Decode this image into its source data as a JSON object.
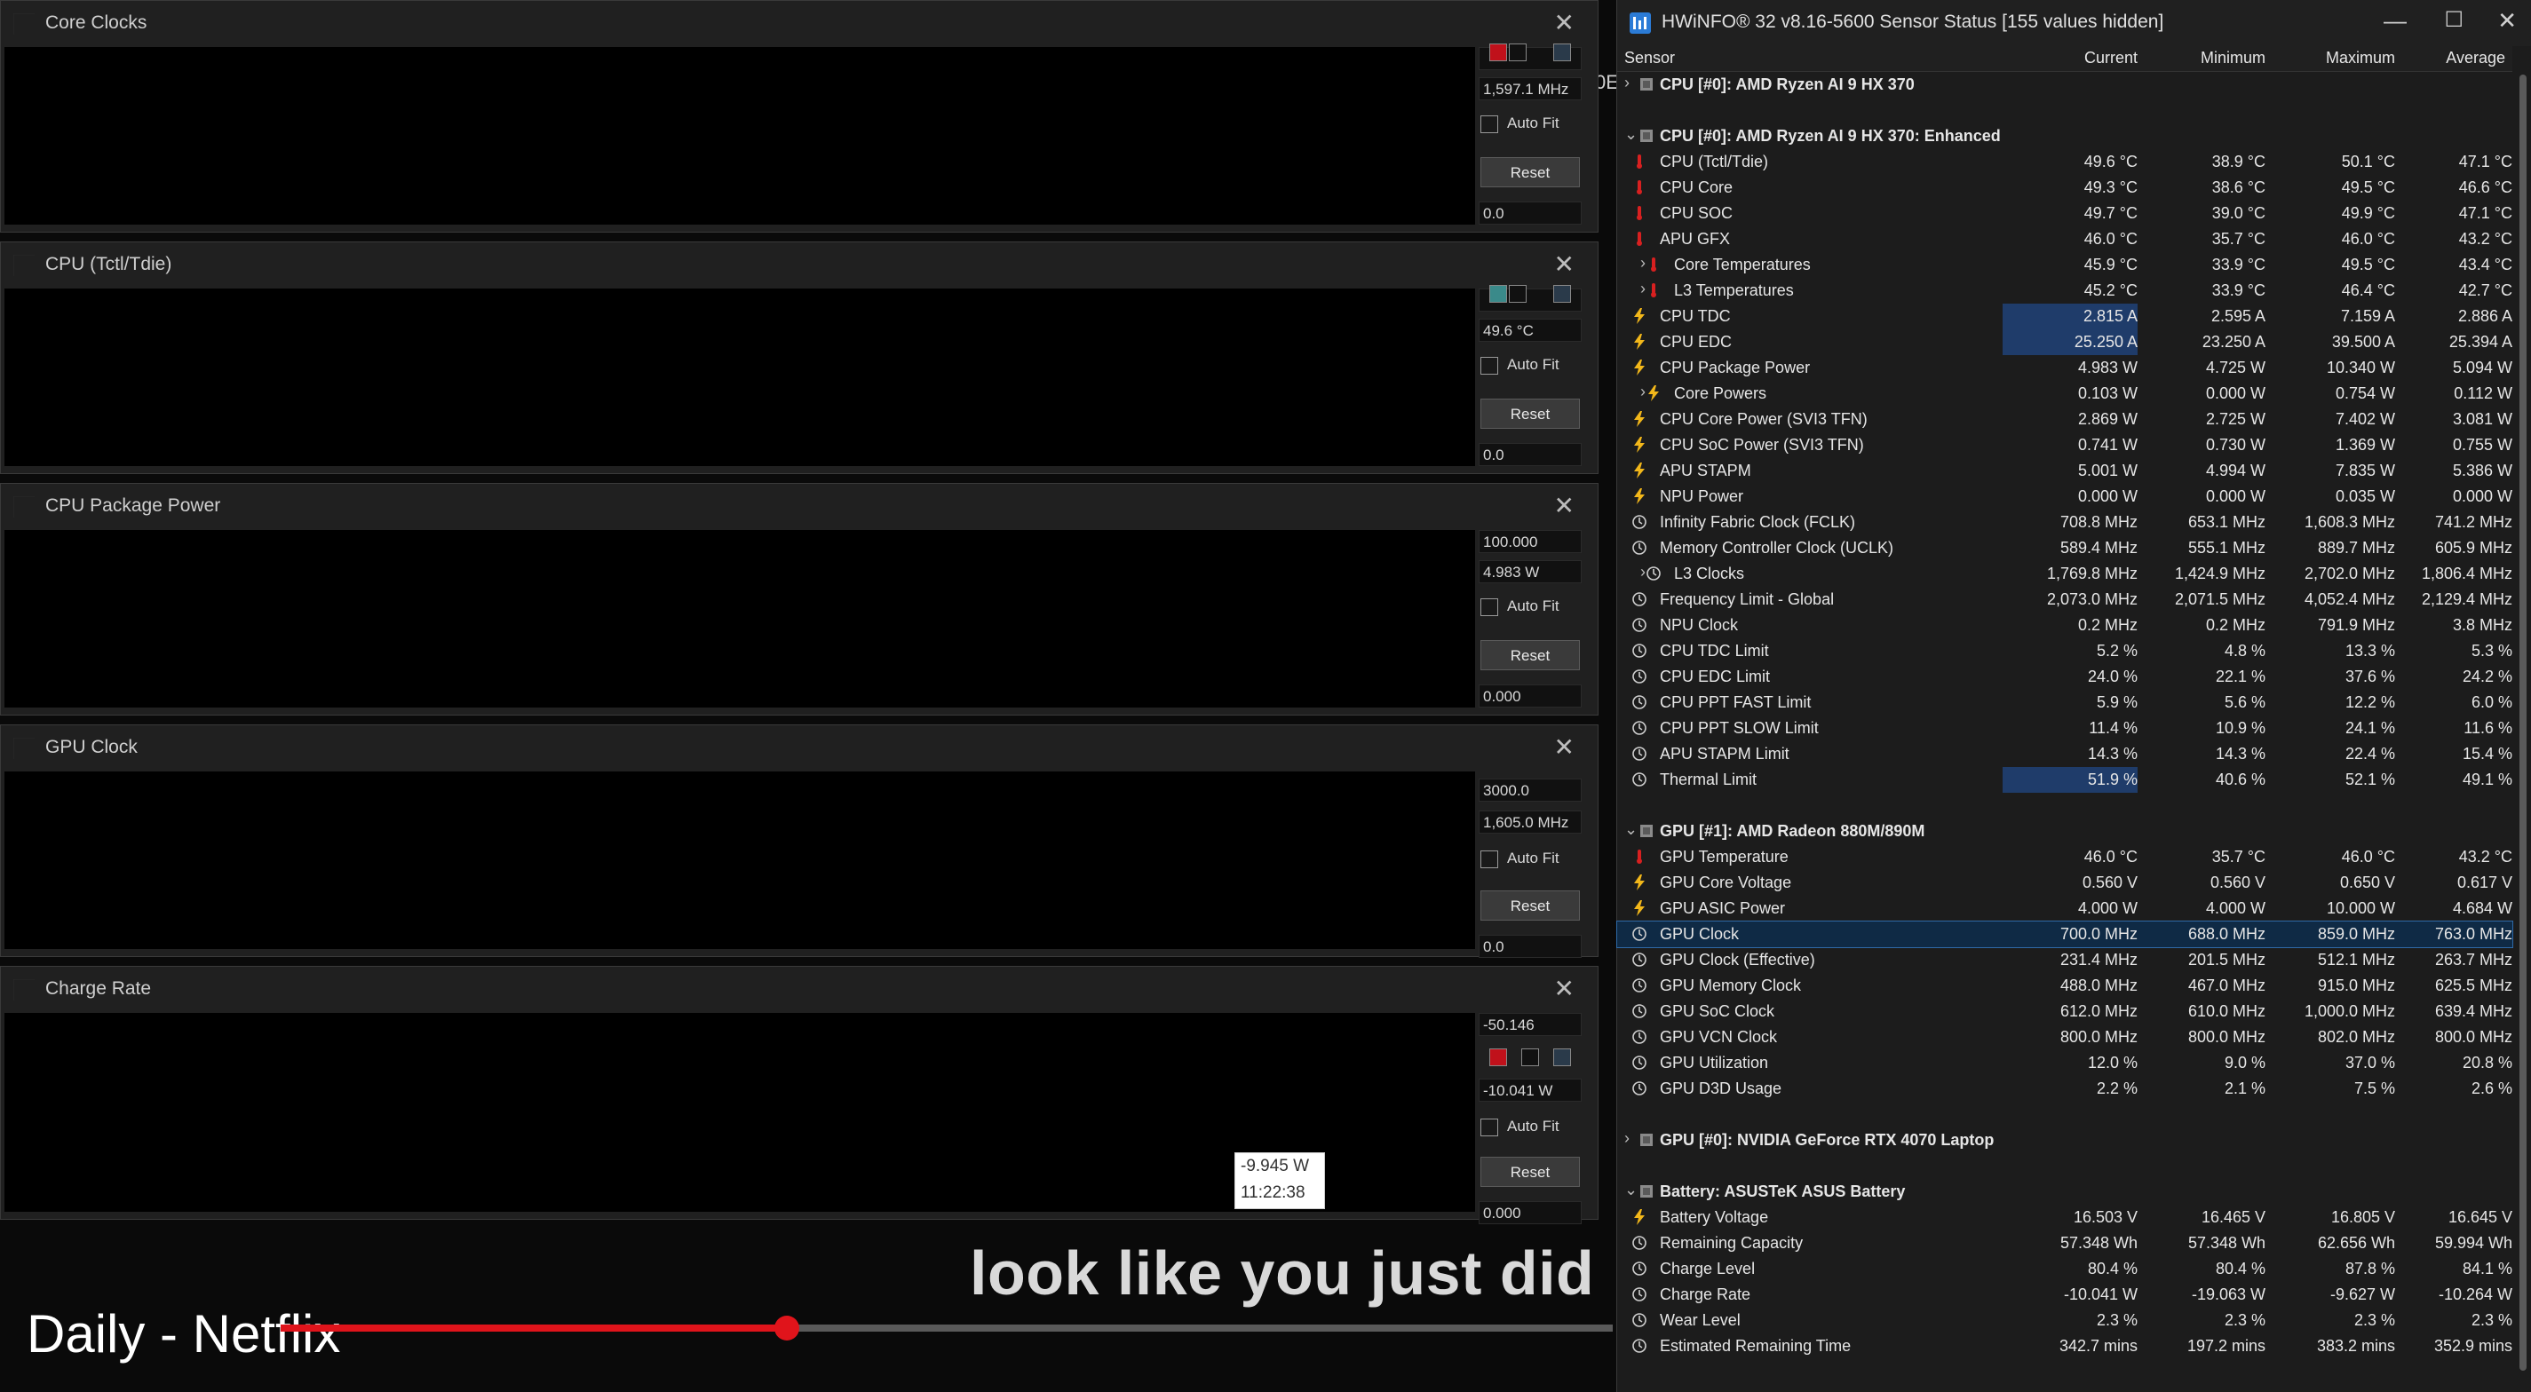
{
  "graphs": [
    {
      "title": "Core Clocks",
      "values": {
        "top": "",
        "current": "1,597.1 MHz",
        "bottom": "0.0"
      },
      "autofit": "Auto Fit",
      "reset": "Reset",
      "color": "#c0111b"
    },
    {
      "title": "CPU (Tctl/Tdie)",
      "values": {
        "top": "",
        "current": "49.6 °C",
        "bottom": "0.0"
      },
      "autofit": "Auto Fit",
      "reset": "Reset",
      "color": "#3a8a8a"
    },
    {
      "title": "CPU Package Power",
      "values": {
        "top": "100.000",
        "current": "4.983 W",
        "bottom": "0.000"
      },
      "autofit": "Auto Fit",
      "reset": "Reset",
      "color": "#2a6fcf"
    },
    {
      "title": "GPU Clock",
      "values": {
        "top": "3000.0",
        "current": "1,605.0 MHz",
        "bottom": "0.0"
      },
      "autofit": "Auto Fit",
      "reset": "Reset",
      "color": "#c0111b"
    },
    {
      "title": "Charge Rate",
      "values": {
        "top": "-50.146",
        "current": "-10.041 W",
        "bottom": "0.000"
      },
      "autofit": "Auto Fit",
      "reset": "Reset",
      "color": "#c0111b"
    }
  ],
  "tooltip": {
    "value": "-9.945 W",
    "time": "11:22:38"
  },
  "background_text": "0E",
  "video": {
    "caption": "look like you just did",
    "title": "Daily - Netflix",
    "progress": 0.38
  },
  "hwinfo": {
    "title": "HWiNFO® 32 v8.16-5600 Sensor Status [155 values hidden]",
    "columns": [
      "Sensor",
      "Current",
      "Minimum",
      "Maximum",
      "Average"
    ],
    "rows": [
      {
        "t": "group",
        "exp": "›",
        "name": "CPU [#0]: AMD Ryzen AI 9 HX 370",
        "ico": "chip-icon"
      },
      {
        "t": "blank"
      },
      {
        "t": "group",
        "exp": "⌄",
        "name": "CPU [#0]: AMD Ryzen AI 9 HX 370: Enhanced",
        "ico": "chip-icon"
      },
      {
        "t": "s",
        "ico": "thermometer-icon",
        "name": "CPU (Tctl/Tdie)",
        "v": [
          "49.6 °C",
          "38.9 °C",
          "50.1 °C",
          "47.1 °C"
        ]
      },
      {
        "t": "s",
        "ico": "thermometer-icon",
        "name": "CPU Core",
        "v": [
          "49.3 °C",
          "38.6 °C",
          "49.5 °C",
          "46.6 °C"
        ]
      },
      {
        "t": "s",
        "ico": "thermometer-icon",
        "name": "CPU SOC",
        "v": [
          "49.7 °C",
          "39.0 °C",
          "49.9 °C",
          "47.1 °C"
        ]
      },
      {
        "t": "s",
        "ico": "thermometer-icon",
        "name": "APU GFX",
        "v": [
          "46.0 °C",
          "35.7 °C",
          "46.0 °C",
          "43.2 °C"
        ]
      },
      {
        "t": "s",
        "ico": "thermometer-icon",
        "name": "Core Temperatures",
        "sub": true,
        "exp": "›",
        "v": [
          "45.9 °C",
          "33.9 °C",
          "49.5 °C",
          "43.4 °C"
        ]
      },
      {
        "t": "s",
        "ico": "thermometer-icon",
        "name": "L3 Temperatures",
        "sub": true,
        "exp": "›",
        "v": [
          "45.2 °C",
          "33.9 °C",
          "46.4 °C",
          "42.7 °C"
        ]
      },
      {
        "t": "s",
        "ico": "bolt-icon",
        "name": "CPU TDC",
        "hl": true,
        "v": [
          "2.815 A",
          "2.595 A",
          "7.159 A",
          "2.886 A"
        ]
      },
      {
        "t": "s",
        "ico": "bolt-icon",
        "name": "CPU EDC",
        "hl": true,
        "v": [
          "25.250 A",
          "23.250 A",
          "39.500 A",
          "25.394 A"
        ]
      },
      {
        "t": "s",
        "ico": "bolt-icon",
        "name": "CPU Package Power",
        "v": [
          "4.983 W",
          "4.725 W",
          "10.340 W",
          "5.094 W"
        ]
      },
      {
        "t": "s",
        "ico": "bolt-icon",
        "name": "Core Powers",
        "sub": true,
        "exp": "›",
        "v": [
          "0.103 W",
          "0.000 W",
          "0.754 W",
          "0.112 W"
        ]
      },
      {
        "t": "s",
        "ico": "bolt-icon",
        "name": "CPU Core Power (SVI3 TFN)",
        "v": [
          "2.869 W",
          "2.725 W",
          "7.402 W",
          "3.081 W"
        ]
      },
      {
        "t": "s",
        "ico": "bolt-icon",
        "name": "CPU SoC Power (SVI3 TFN)",
        "v": [
          "0.741 W",
          "0.730 W",
          "1.369 W",
          "0.755 W"
        ]
      },
      {
        "t": "s",
        "ico": "bolt-icon",
        "name": "APU STAPM",
        "v": [
          "5.001 W",
          "4.994 W",
          "7.835 W",
          "5.386 W"
        ]
      },
      {
        "t": "s",
        "ico": "bolt-icon",
        "name": "NPU Power",
        "v": [
          "0.000 W",
          "0.000 W",
          "0.035 W",
          "0.000 W"
        ]
      },
      {
        "t": "s",
        "ico": "clock-icon",
        "name": "Infinity Fabric Clock (FCLK)",
        "v": [
          "708.8 MHz",
          "653.1 MHz",
          "1,608.3 MHz",
          "741.2 MHz"
        ]
      },
      {
        "t": "s",
        "ico": "clock-icon",
        "name": "Memory Controller Clock (UCLK)",
        "v": [
          "589.4 MHz",
          "555.1 MHz",
          "889.7 MHz",
          "605.9 MHz"
        ]
      },
      {
        "t": "s",
        "ico": "clock-icon",
        "name": "L3 Clocks",
        "sub": true,
        "exp": "›",
        "v": [
          "1,769.8 MHz",
          "1,424.9 MHz",
          "2,702.0 MHz",
          "1,806.4 MHz"
        ]
      },
      {
        "t": "s",
        "ico": "clock-icon",
        "name": "Frequency Limit - Global",
        "v": [
          "2,073.0 MHz",
          "2,071.5 MHz",
          "4,052.4 MHz",
          "2,129.4 MHz"
        ]
      },
      {
        "t": "s",
        "ico": "clock-icon",
        "name": "NPU Clock",
        "v": [
          "0.2 MHz",
          "0.2 MHz",
          "791.9 MHz",
          "3.8 MHz"
        ]
      },
      {
        "t": "s",
        "ico": "clock-icon",
        "name": "CPU TDC Limit",
        "v": [
          "5.2 %",
          "4.8 %",
          "13.3 %",
          "5.3 %"
        ]
      },
      {
        "t": "s",
        "ico": "clock-icon",
        "name": "CPU EDC Limit",
        "v": [
          "24.0 %",
          "22.1 %",
          "37.6 %",
          "24.2 %"
        ]
      },
      {
        "t": "s",
        "ico": "clock-icon",
        "name": "CPU PPT FAST Limit",
        "v": [
          "5.9 %",
          "5.6 %",
          "12.2 %",
          "6.0 %"
        ]
      },
      {
        "t": "s",
        "ico": "clock-icon",
        "name": "CPU PPT SLOW Limit",
        "v": [
          "11.4 %",
          "10.9 %",
          "24.1 %",
          "11.6 %"
        ]
      },
      {
        "t": "s",
        "ico": "clock-icon",
        "name": "APU STAPM Limit",
        "v": [
          "14.3 %",
          "14.3 %",
          "22.4 %",
          "15.4 %"
        ]
      },
      {
        "t": "s",
        "ico": "clock-icon",
        "name": "Thermal Limit",
        "hl": true,
        "v": [
          "51.9 %",
          "40.6 %",
          "52.1 %",
          "49.1 %"
        ]
      },
      {
        "t": "blank"
      },
      {
        "t": "group",
        "exp": "⌄",
        "name": "GPU [#1]: AMD Radeon 880M/890M",
        "ico": "chip-icon"
      },
      {
        "t": "s",
        "ico": "thermometer-icon",
        "name": "GPU Temperature",
        "v": [
          "46.0 °C",
          "35.7 °C",
          "46.0 °C",
          "43.2 °C"
        ]
      },
      {
        "t": "s",
        "ico": "bolt-icon",
        "name": "GPU Core Voltage",
        "v": [
          "0.560 V",
          "0.560 V",
          "0.650 V",
          "0.617 V"
        ]
      },
      {
        "t": "s",
        "ico": "bolt-icon",
        "name": "GPU ASIC Power",
        "v": [
          "4.000 W",
          "4.000 W",
          "10.000 W",
          "4.684 W"
        ]
      },
      {
        "t": "s",
        "ico": "clock-icon",
        "name": "GPU Clock",
        "sel": true,
        "v": [
          "700.0 MHz",
          "688.0 MHz",
          "859.0 MHz",
          "763.0 MHz"
        ]
      },
      {
        "t": "s",
        "ico": "clock-icon",
        "name": "GPU Clock (Effective)",
        "v": [
          "231.4 MHz",
          "201.5 MHz",
          "512.1 MHz",
          "263.7 MHz"
        ]
      },
      {
        "t": "s",
        "ico": "clock-icon",
        "name": "GPU Memory Clock",
        "v": [
          "488.0 MHz",
          "467.0 MHz",
          "915.0 MHz",
          "625.5 MHz"
        ]
      },
      {
        "t": "s",
        "ico": "clock-icon",
        "name": "GPU SoC Clock",
        "v": [
          "612.0 MHz",
          "610.0 MHz",
          "1,000.0 MHz",
          "639.4 MHz"
        ]
      },
      {
        "t": "s",
        "ico": "clock-icon",
        "name": "GPU VCN Clock",
        "v": [
          "800.0 MHz",
          "800.0 MHz",
          "802.0 MHz",
          "800.0 MHz"
        ]
      },
      {
        "t": "s",
        "ico": "clock-icon",
        "name": "GPU Utilization",
        "v": [
          "12.0 %",
          "9.0 %",
          "37.0 %",
          "20.8 %"
        ]
      },
      {
        "t": "s",
        "ico": "clock-icon",
        "name": "GPU D3D Usage",
        "v": [
          "2.2 %",
          "2.1 %",
          "7.5 %",
          "2.6 %"
        ]
      },
      {
        "t": "blank"
      },
      {
        "t": "group",
        "exp": "›",
        "name": "GPU [#0]: NVIDIA GeForce RTX 4070 Laptop",
        "ico": "chip-icon"
      },
      {
        "t": "blank"
      },
      {
        "t": "group",
        "exp": "⌄",
        "name": "Battery: ASUSTeK ASUS Battery",
        "ico": "chip-icon"
      },
      {
        "t": "s",
        "ico": "bolt-icon",
        "name": "Battery Voltage",
        "v": [
          "16.503 V",
          "16.465 V",
          "16.805 V",
          "16.645 V"
        ]
      },
      {
        "t": "s",
        "ico": "clock-icon",
        "name": "Remaining Capacity",
        "v": [
          "57.348 Wh",
          "57.348 Wh",
          "62.656 Wh",
          "59.994 Wh"
        ]
      },
      {
        "t": "s",
        "ico": "clock-icon",
        "name": "Charge Level",
        "v": [
          "80.4 %",
          "80.4 %",
          "87.8 %",
          "84.1 %"
        ]
      },
      {
        "t": "s",
        "ico": "clock-icon",
        "name": "Charge Rate",
        "v": [
          "-10.041 W",
          "-19.063 W",
          "-9.627 W",
          "-10.264 W"
        ]
      },
      {
        "t": "s",
        "ico": "clock-icon",
        "name": "Wear Level",
        "v": [
          "2.3 %",
          "2.3 %",
          "2.3 %",
          "2.3 %"
        ]
      },
      {
        "t": "s",
        "ico": "clock-icon",
        "name": "Estimated Remaining Time",
        "v": [
          "342.7 mins",
          "197.2 mins",
          "383.2 mins",
          "352.9 mins"
        ]
      }
    ]
  }
}
